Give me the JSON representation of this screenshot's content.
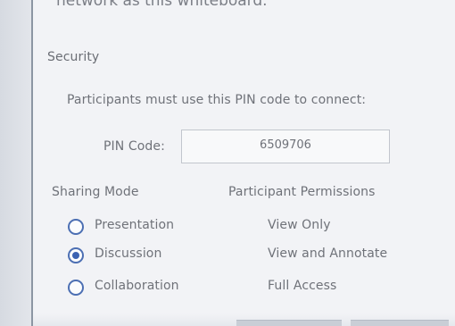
{
  "panel": {
    "cut_text": "network as this whiteboard.",
    "security_title": "Security",
    "instruction": "Participants must use this PIN code to connect:",
    "pin_label": "PIN Code:",
    "pin_value": "6509706",
    "sharing_mode_label": "Sharing Mode",
    "permissions_label": "Participant Permissions",
    "options": [
      {
        "label": "Presentation",
        "permission": "View Only",
        "selected": false
      },
      {
        "label": "Discussion",
        "permission": "View and Annotate",
        "selected": true
      },
      {
        "label": "Collaboration",
        "permission": "Full Access",
        "selected": false
      }
    ]
  },
  "colors": {
    "radio_accent": "#3b62b2",
    "text": "#6f7279",
    "panel_bg": "#f2f3f6"
  }
}
